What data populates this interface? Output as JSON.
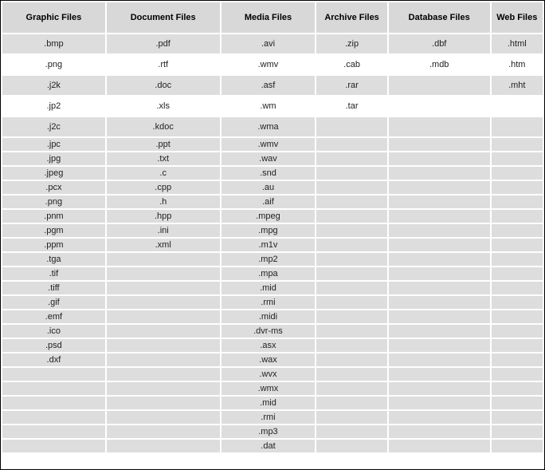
{
  "headers": [
    "Graphic Files",
    "Document Files",
    "Media Files",
    "Archive Files",
    "Database Files",
    "Web Files"
  ],
  "cols": {
    "graphic": [
      ".bmp",
      ".png",
      ".j2k",
      ".jp2",
      ".j2c",
      ".jpc",
      ".jpg",
      ".jpeg",
      ".pcx",
      ".png",
      ".pnm",
      ".pgm",
      ".ppm",
      ".tga",
      ".tif",
      ".tiff",
      ".gif",
      ".emf",
      ".ico",
      ".psd",
      ".dxf"
    ],
    "document": [
      ".pdf",
      ".rtf",
      ".doc",
      ".xls",
      ".kdoc",
      ".ppt",
      ".txt",
      ".c",
      ".cpp",
      ".h",
      ".hpp",
      ".ini",
      ".xml"
    ],
    "media": [
      ".avi",
      ".wmv",
      ".asf",
      ".wm",
      ".wma",
      ".wmv",
      ".wav",
      ".snd",
      ".au",
      ".aif",
      ".mpeg",
      ".mpg",
      ".m1v",
      ".mp2",
      ".mpa",
      ".mid",
      ".rmi",
      ".midi",
      ".dvr-ms",
      ".asx",
      ".wax",
      ".wvx",
      ".wmx",
      ".mid",
      ".rmi",
      ".mp3",
      ".dat"
    ],
    "archive": [
      ".zip",
      ".cab",
      ".rar",
      ".tar"
    ],
    "database": [
      ".dbf",
      ".mdb"
    ],
    "web": [
      ".html",
      ".htm",
      ".mht"
    ]
  },
  "bigRows": 5,
  "totalRows": 27
}
